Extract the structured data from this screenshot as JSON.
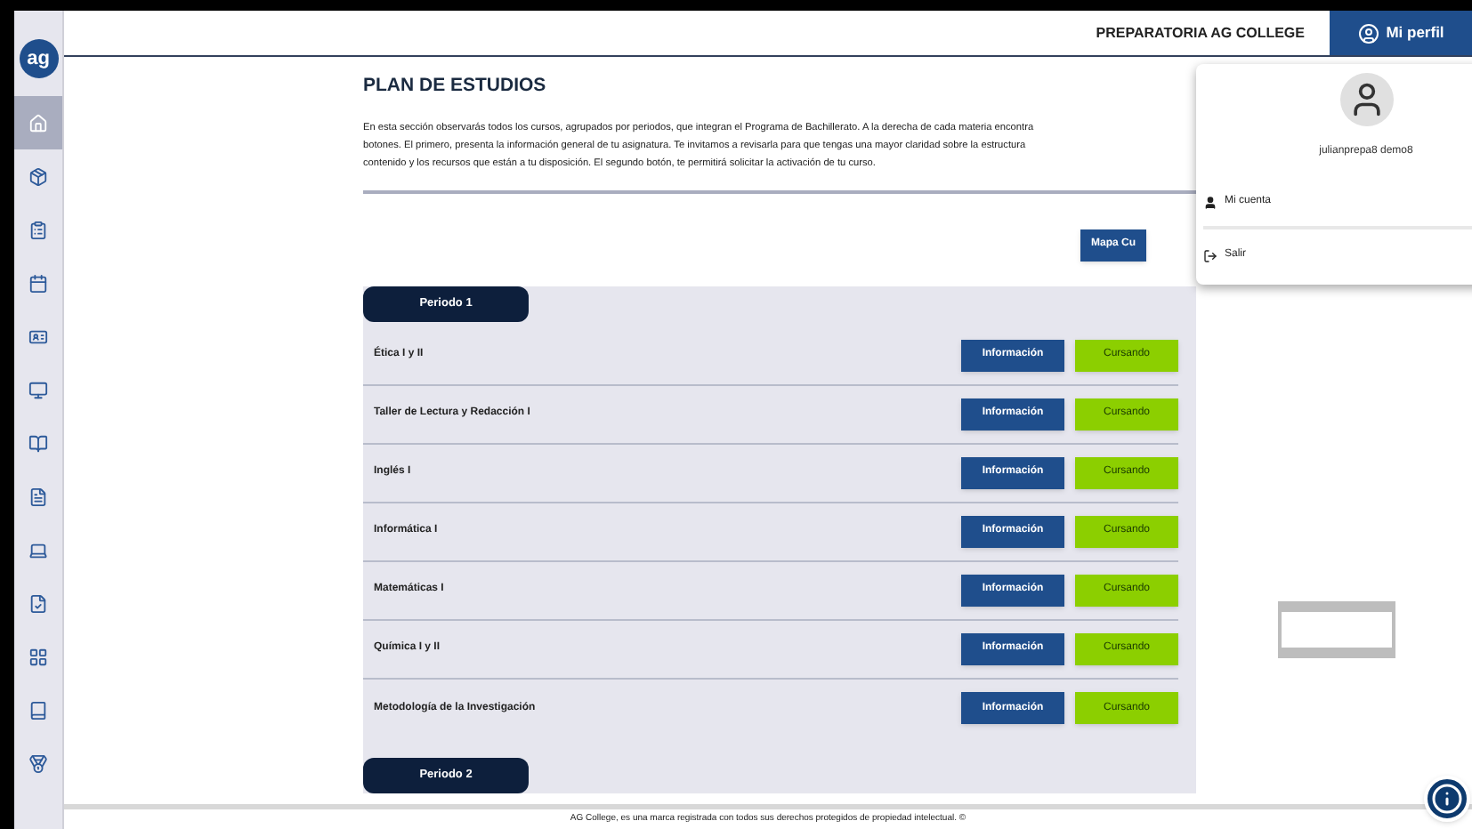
{
  "header": {
    "school": "PREPARATORIA AG COLLEGE",
    "profile_button": "Mi perfil"
  },
  "sidebar": {
    "logo": "ag",
    "items": [
      {
        "selected": true
      },
      {
        "selected": false
      },
      {
        "selected": false
      },
      {
        "selected": false
      },
      {
        "selected": false
      },
      {
        "selected": false
      },
      {
        "selected": false
      },
      {
        "selected": false
      },
      {
        "selected": false
      },
      {
        "selected": false
      },
      {
        "selected": false
      },
      {
        "selected": false
      },
      {
        "selected": false
      }
    ]
  },
  "page": {
    "title": "PLAN DE ESTUDIOS",
    "paragraph_lines": [
      "En esta sección observarás todos los cursos, agrupados por periodos, que integran el Programa de Bachillerato. A la derecha de cada materia encontra",
      "botones. El primero, presenta la información general de tu asignatura. Te invitamos a revisarla para que tengas una mayor claridad sobre la estructura",
      "contenido y los recursos que están a tu disposición. El segundo botón, te permitirá solicitar la activación de tu curso."
    ],
    "map_button": "Mapa Cu"
  },
  "periods": [
    {
      "label": "Periodo 1",
      "courses": [
        {
          "name": "Ética I y II",
          "info": "Información",
          "status": "Cursando"
        },
        {
          "name": "Taller de Lectura y Redacción I",
          "info": "Información",
          "status": "Cursando"
        },
        {
          "name": "Inglés I",
          "info": "Información",
          "status": "Cursando"
        },
        {
          "name": "Informática I",
          "info": "Información",
          "status": "Cursando"
        },
        {
          "name": "Matemáticas I",
          "info": "Información",
          "status": "Cursando"
        },
        {
          "name": "Química I y II",
          "info": "Información",
          "status": "Cursando"
        },
        {
          "name": "Metodología de la Investigación",
          "info": "Información",
          "status": "Cursando"
        }
      ]
    },
    {
      "label": "Periodo 2"
    }
  ],
  "profile_menu": {
    "user": "julianprepa8 demo8",
    "items": [
      {
        "kind": "account",
        "label": "Mi cuenta"
      },
      {
        "kind": "logout",
        "label": "Salir"
      }
    ]
  },
  "footer": "AG College, es una marca registrada con todos sus derechos protegidos de propiedad intelectual. ©"
}
